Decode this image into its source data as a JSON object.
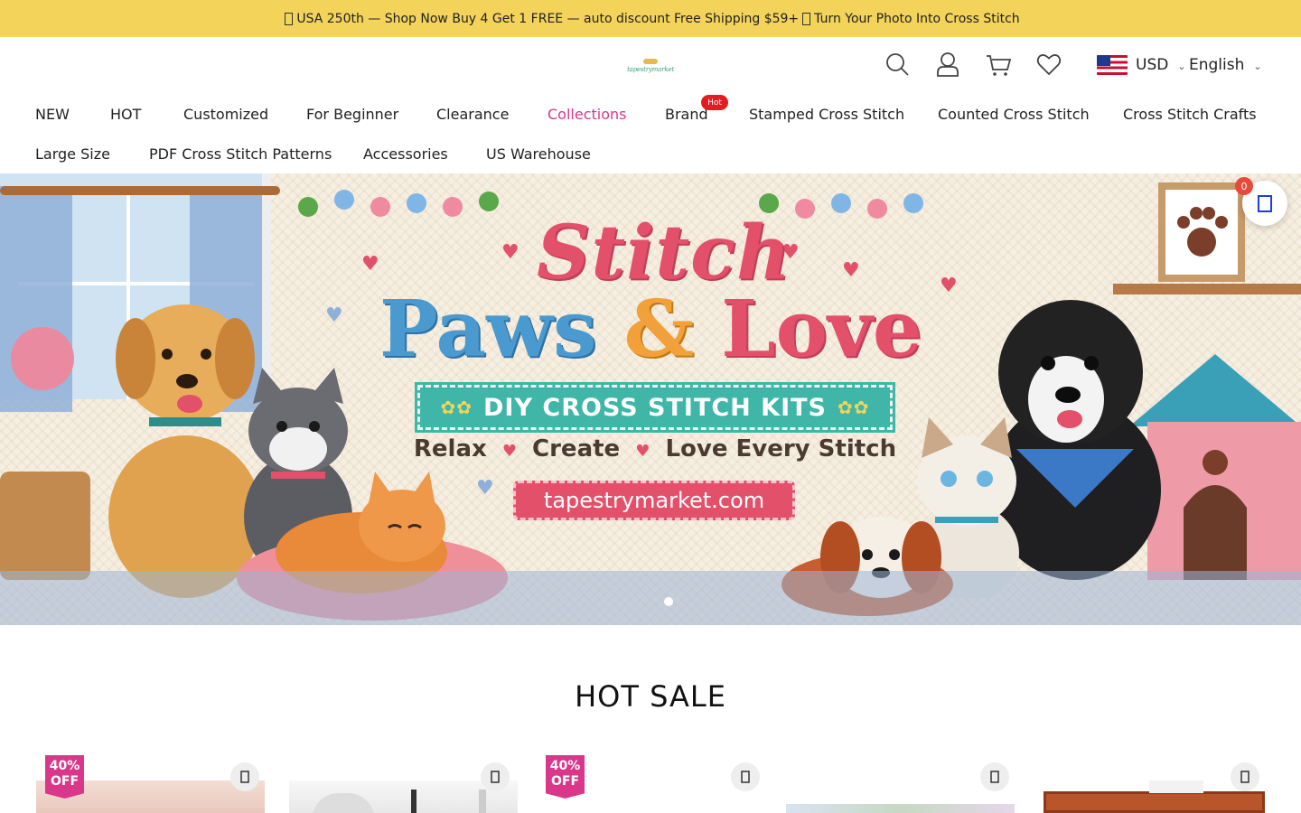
{
  "announcement": {
    "text": "USA 250th — Shop Now Buy 4 Get 1 FREE — auto discount Free Shipping $59+",
    "text2": "Turn Your Photo Into Cross Stitch"
  },
  "header": {
    "logo_text": "tapestrymarket",
    "currency": "USD",
    "language": "English",
    "icons": [
      "search-icon",
      "user-icon",
      "cart-icon",
      "heart-icon"
    ]
  },
  "nav": {
    "row1": [
      "NEW",
      "HOT",
      "Customized",
      "For Beginner",
      "Clearance",
      "Collections",
      "Brand",
      "Stamped Cross Stitch",
      "Counted Cross Stitch",
      "Cross Stitch Crafts"
    ],
    "row2": [
      "Large Size",
      "PDF Cross Stitch Patterns",
      "Accessories",
      "US Warehouse"
    ],
    "active": "Collections",
    "hot_badge": "Hot"
  },
  "hero": {
    "title_line1": "Stitch",
    "title_paws": "Paws",
    "title_amp": "&",
    "title_love": "Love",
    "ribbon": "DIY CROSS STITCH KITS",
    "tagline_parts": [
      "Relax",
      "Create",
      "Love Every Stitch"
    ],
    "url": "tapestrymarket.com",
    "slides": 1,
    "active_slide": 0
  },
  "floating_cart": {
    "count": "0"
  },
  "hot_sale": {
    "title": "HOT SALE",
    "products": [
      {
        "badge_line1": "40%",
        "badge_line2": "OFF"
      },
      {
        "badge_line1": "",
        "badge_line2": ""
      },
      {
        "badge_line1": "40%",
        "badge_line2": "OFF"
      },
      {
        "badge_line1": "",
        "badge_line2": ""
      },
      {
        "badge_line1": "",
        "badge_line2": ""
      }
    ]
  },
  "colors": {
    "announcement_bg": "#f3d35a",
    "accent_pink": "#d8378a",
    "hot_red": "#e31b23",
    "cart_badge": "#e64a3b"
  }
}
